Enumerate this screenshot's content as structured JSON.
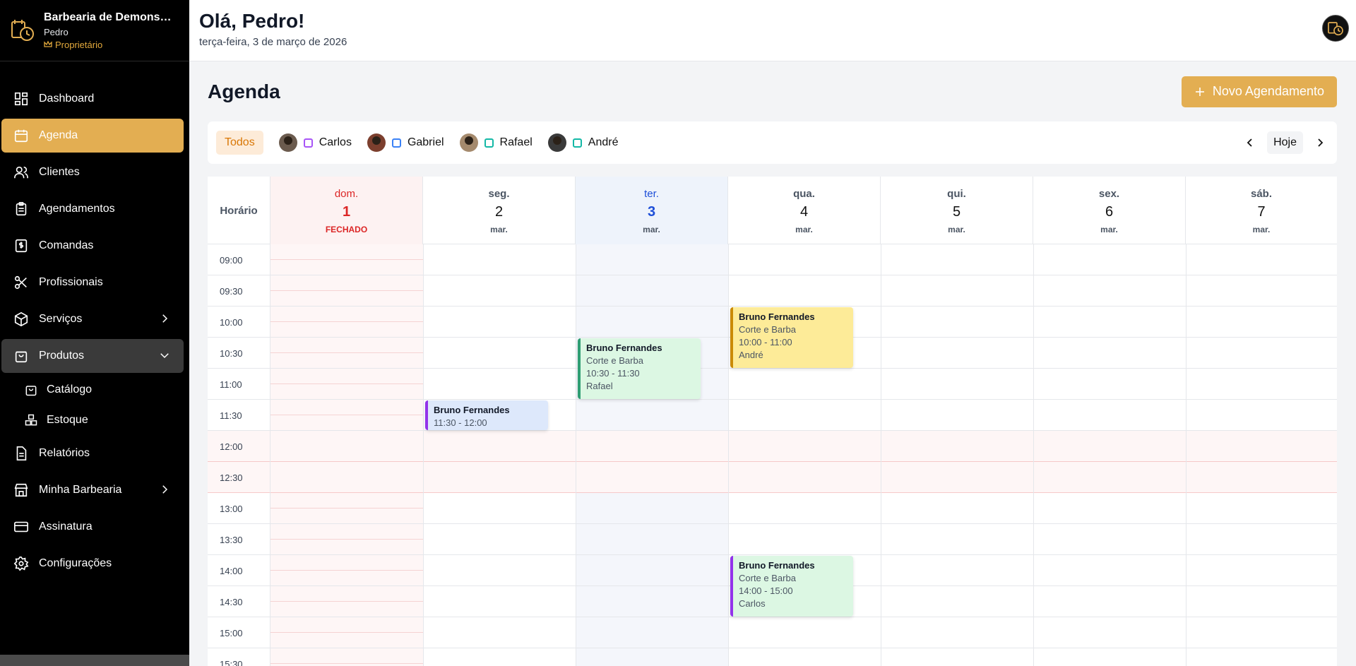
{
  "brand": {
    "title": "Barbearia de Demonstr...",
    "user": "Pedro",
    "role": "Proprietário"
  },
  "nav": {
    "dashboard": "Dashboard",
    "agenda": "Agenda",
    "clientes": "Clientes",
    "agendamentos": "Agendamentos",
    "comandas": "Comandas",
    "profissionais": "Profissionais",
    "servicos": "Serviços",
    "produtos": "Produtos",
    "catalogo": "Catálogo",
    "estoque": "Estoque",
    "relatorios": "Relatórios",
    "minha_barbearia": "Minha Barbearia",
    "assinatura": "Assinatura",
    "configuracoes": "Configurações"
  },
  "header": {
    "greeting": "Olá, Pedro!",
    "date": "terça-feira, 3 de março de 2026"
  },
  "page": {
    "title": "Agenda",
    "new_button": "Novo Agendamento"
  },
  "filters": {
    "all": "Todos",
    "professionals": [
      {
        "name": "Carlos",
        "color": "#a855f7"
      },
      {
        "name": "Gabriel",
        "color": "#3b82f6"
      },
      {
        "name": "Rafael",
        "color": "#14b8a6"
      },
      {
        "name": "André",
        "color": "#14b8a6"
      }
    ],
    "today": "Hoje"
  },
  "calendar": {
    "time_header": "Horário",
    "days": [
      {
        "dow": "dom.",
        "num": "1",
        "sub": "FECHADO"
      },
      {
        "dow": "seg.",
        "num": "2",
        "sub": "mar."
      },
      {
        "dow": "ter.",
        "num": "3",
        "sub": "mar."
      },
      {
        "dow": "qua.",
        "num": "4",
        "sub": "mar."
      },
      {
        "dow": "qui.",
        "num": "5",
        "sub": "mar."
      },
      {
        "dow": "sex.",
        "num": "6",
        "sub": "mar."
      },
      {
        "dow": "sáb.",
        "num": "7",
        "sub": "mar."
      }
    ],
    "times": [
      "09:00",
      "09:30",
      "10:00",
      "10:30",
      "11:00",
      "11:30",
      "12:00",
      "12:30",
      "13:00",
      "13:30",
      "14:00",
      "14:30",
      "15:00",
      "15:30"
    ],
    "appointments": [
      {
        "client": "Bruno Fernandes",
        "service": "Corte e Barba",
        "time": "10:00 - 11:00",
        "professional": "André",
        "day": 3,
        "bg": "#fdeb98",
        "border": "#ca8a04"
      },
      {
        "client": "Bruno Fernandes",
        "service": "Corte e Barba",
        "time": "10:30 - 11:30",
        "professional": "Rafael",
        "day": 2,
        "bg": "#dcf7e3",
        "border": "#2f9e73"
      },
      {
        "client": "Bruno Fernandes",
        "service": "",
        "time": "11:30 - 12:00",
        "professional": "",
        "day": 1,
        "bg": "#dde8fb",
        "border": "#9333ea"
      },
      {
        "client": "Bruno Fernandes",
        "service": "Corte e Barba",
        "time": "14:00 - 15:00",
        "professional": "Carlos",
        "day": 3,
        "bg": "#dcf7e3",
        "border": "#9333ea"
      }
    ]
  }
}
